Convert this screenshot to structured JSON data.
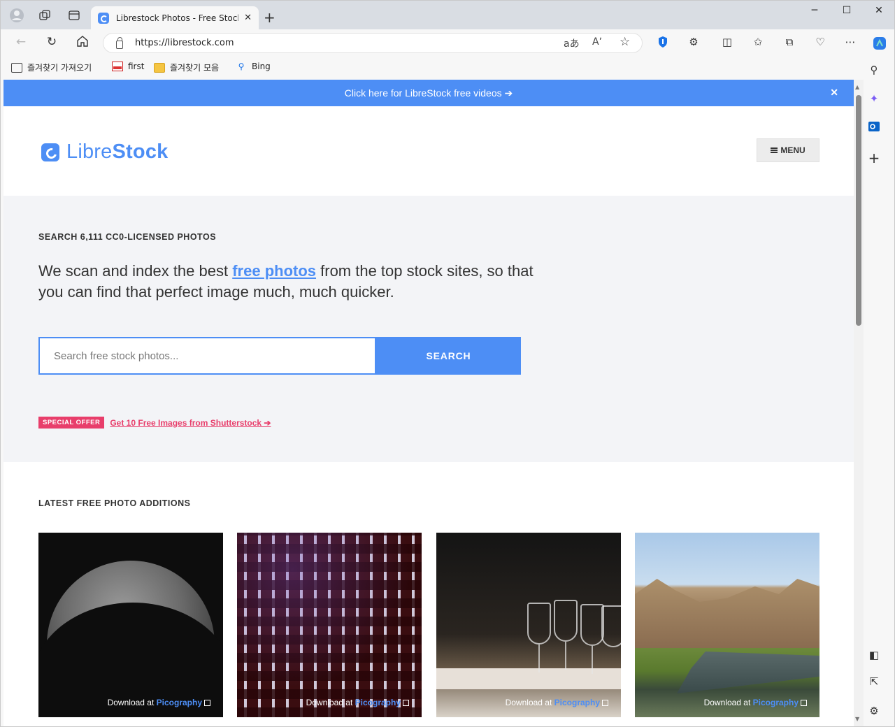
{
  "browser": {
    "tab_title": "Librestock Photos - Free Stock Ph",
    "url": "https://librestock.com",
    "favorites": [
      {
        "label": "즐겨찾기 가져오기",
        "icon": "import-icon"
      },
      {
        "label": "first",
        "icon": "pdf-icon"
      },
      {
        "label": "즐겨찾기 모음",
        "icon": "folder-icon"
      },
      {
        "label": "Bing",
        "icon": "bing-search-icon"
      }
    ]
  },
  "promo": {
    "text": "Click here for LibreStock free videos ➔",
    "close": "✕"
  },
  "header": {
    "logo_light": "Libre",
    "logo_bold": "Stock",
    "menu_label": "MENU"
  },
  "hero": {
    "kicker": "SEARCH 6,111 CC0-LICENSED PHOTOS",
    "lead_before": "We scan and index the best ",
    "lead_link": "free photos",
    "lead_after": " from the top stock sites, so that you can find that perfect image much, much quicker.",
    "search_placeholder": "Search free stock photos...",
    "search_button": "SEARCH",
    "offer_badge": "SPECIAL OFFER",
    "offer_link": "Get 10 Free Images from Shutterstock ➔"
  },
  "latest": {
    "title": "LATEST FREE PHOTO ADDITIONS",
    "photos": [
      {
        "prefix": "Download at ",
        "source": "Picography",
        "subject": "moon"
      },
      {
        "prefix": "Download at ",
        "source": "Picography",
        "subject": "lights"
      },
      {
        "prefix": "Download at ",
        "source": "Picography",
        "subject": "wine"
      },
      {
        "prefix": "Download at ",
        "source": "Picography",
        "subject": "river"
      }
    ]
  },
  "colors": {
    "brand": "#4d8ef5",
    "offer": "#e83e6b",
    "hero_bg": "#f3f4f7"
  }
}
